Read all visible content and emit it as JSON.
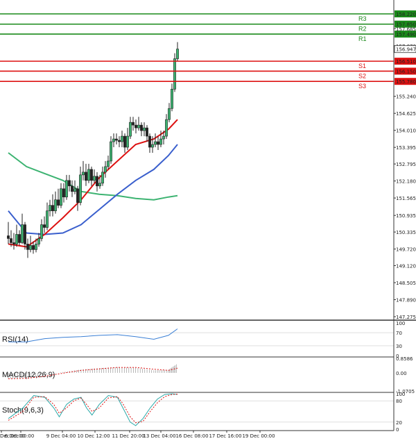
{
  "chart_data": {
    "type": "candlestick",
    "y_axis_labels": [
      "158.220",
      "157.850",
      "157.685",
      "157.490",
      "157.070",
      "156.947",
      "156.510",
      "156.150",
      "155.780",
      "155.240",
      "154.625",
      "154.010",
      "153.395",
      "152.795",
      "152.180",
      "151.565",
      "150.935",
      "150.335",
      "149.720",
      "149.120",
      "148.505",
      "147.890",
      "147.275"
    ],
    "x_labels": [
      "Dec 00:00",
      "6 Dec 00:00",
      "9 Dec 04:00",
      "10 Dec 12:00",
      "11 Dec 20:00",
      "13 Dec 04:00",
      "16 Dec 08:00",
      "17 Dec 16:00",
      "19 Dec 00:00"
    ],
    "ylim": [
      147.275,
      158.5
    ],
    "current_price": 156.947,
    "levels": [
      {
        "name": "R3",
        "value": 158.22,
        "price_label": "158.220",
        "color": "#1a8a1a"
      },
      {
        "name": "R2",
        "value": 157.85,
        "price_label": "157.850",
        "color": "#1a8a1a"
      },
      {
        "name": "R1",
        "value": 157.49,
        "price_label": "157.490",
        "color": "#1a8a1a"
      },
      {
        "name": "S1",
        "value": 156.51,
        "price_label": "156.510",
        "color": "#dd1111"
      },
      {
        "name": "S2",
        "value": 156.15,
        "price_label": "156.150",
        "color": "#dd1111"
      },
      {
        "name": "S3",
        "value": 155.78,
        "price_label": "155.780",
        "color": "#dd1111"
      }
    ],
    "level_tags": [
      "R3",
      "R2",
      "R1",
      "S1",
      "S2",
      "S3"
    ],
    "candles": [
      [
        150.2,
        150.1,
        150.7,
        149.9
      ],
      [
        150.1,
        149.95,
        150.4,
        149.8
      ],
      [
        149.95,
        149.9,
        150.3,
        149.7
      ],
      [
        149.9,
        150.25,
        150.6,
        149.8
      ],
      [
        150.25,
        149.95,
        150.4,
        149.85
      ],
      [
        149.95,
        150.6,
        151.0,
        149.9
      ],
      [
        150.6,
        149.9,
        150.7,
        149.7
      ],
      [
        149.9,
        149.7,
        150.1,
        149.4
      ],
      [
        149.7,
        149.85,
        150.2,
        149.6
      ],
      [
        149.85,
        149.7,
        150.0,
        149.55
      ],
      [
        149.7,
        149.9,
        150.1,
        149.6
      ],
      [
        149.9,
        150.1,
        150.3,
        149.8
      ],
      [
        150.1,
        150.6,
        150.8,
        150.0
      ],
      [
        150.6,
        150.5,
        150.9,
        150.3
      ],
      [
        150.5,
        151.1,
        151.4,
        150.4
      ],
      [
        151.1,
        151.3,
        151.5,
        150.9
      ],
      [
        151.3,
        151.1,
        151.7,
        150.9
      ],
      [
        151.1,
        151.5,
        151.8,
        151.0
      ],
      [
        151.5,
        151.3,
        151.9,
        151.2
      ],
      [
        151.3,
        151.9,
        152.1,
        151.2
      ],
      [
        151.9,
        151.6,
        152.1,
        151.4
      ],
      [
        151.6,
        152.2,
        152.4,
        151.5
      ],
      [
        152.2,
        152.0,
        152.4,
        151.8
      ],
      [
        152.0,
        151.8,
        152.2,
        151.6
      ],
      [
        151.8,
        151.9,
        152.2,
        151.7
      ],
      [
        151.9,
        151.4,
        152.0,
        151.1
      ],
      [
        151.4,
        152.4,
        152.7,
        151.3
      ],
      [
        152.4,
        152.5,
        152.9,
        152.2
      ],
      [
        152.5,
        152.2,
        152.8,
        152.0
      ],
      [
        152.2,
        152.6,
        152.8,
        152.1
      ],
      [
        152.6,
        152.2,
        152.7,
        152.0
      ],
      [
        152.2,
        152.35,
        152.6,
        152.1
      ],
      [
        152.35,
        152.0,
        152.5,
        151.8
      ],
      [
        152.0,
        152.1,
        152.4,
        151.9
      ],
      [
        152.1,
        152.5,
        152.7,
        152.0
      ],
      [
        152.5,
        152.7,
        152.9,
        152.3
      ],
      [
        152.7,
        152.9,
        153.1,
        152.6
      ],
      [
        152.9,
        153.6,
        153.8,
        152.8
      ],
      [
        153.6,
        153.7,
        153.9,
        153.4
      ],
      [
        153.7,
        153.65,
        153.9,
        153.5
      ],
      [
        153.65,
        153.6,
        153.8,
        153.4
      ],
      [
        153.6,
        153.8,
        154.0,
        153.4
      ],
      [
        153.8,
        153.4,
        153.9,
        153.2
      ],
      [
        153.4,
        153.8,
        154.1,
        153.3
      ],
      [
        153.8,
        154.3,
        154.5,
        153.7
      ],
      [
        154.3,
        154.2,
        154.5,
        154.0
      ],
      [
        154.2,
        154.1,
        154.4,
        153.9
      ],
      [
        154.1,
        154.2,
        154.5,
        154.0
      ],
      [
        154.2,
        154.0,
        154.3,
        153.8
      ],
      [
        154.0,
        154.1,
        154.3,
        153.8
      ],
      [
        154.1,
        153.8,
        154.2,
        153.6
      ],
      [
        153.8,
        153.4,
        153.9,
        153.2
      ],
      [
        153.4,
        153.5,
        153.8,
        153.2
      ],
      [
        153.5,
        153.6,
        153.9,
        153.4
      ],
      [
        153.6,
        153.5,
        153.8,
        153.3
      ],
      [
        153.5,
        153.7,
        154.0,
        153.4
      ],
      [
        153.7,
        153.8,
        154.0,
        153.5
      ],
      [
        153.8,
        154.4,
        154.6,
        153.7
      ],
      [
        154.4,
        154.8,
        155.0,
        154.3
      ],
      [
        154.8,
        155.5,
        155.7,
        154.7
      ],
      [
        155.5,
        156.6,
        156.8,
        155.4
      ],
      [
        156.6,
        156.95,
        157.2,
        156.5
      ]
    ],
    "ma_red": [
      [
        0,
        149.9
      ],
      [
        10,
        149.8
      ],
      [
        20,
        150.25
      ],
      [
        30,
        150.85
      ],
      [
        40,
        151.5
      ],
      [
        50,
        152.3
      ],
      [
        60,
        152.9
      ],
      [
        70,
        153.5
      ],
      [
        80,
        153.7
      ],
      [
        88,
        154.05
      ],
      [
        93,
        154.4
      ]
    ],
    "ma_blue": [
      [
        0,
        151.1
      ],
      [
        10,
        150.3
      ],
      [
        20,
        150.25
      ],
      [
        30,
        150.3
      ],
      [
        40,
        150.6
      ],
      [
        50,
        151.15
      ],
      [
        60,
        151.7
      ],
      [
        70,
        152.2
      ],
      [
        80,
        152.6
      ],
      [
        88,
        153.1
      ],
      [
        93,
        153.5
      ]
    ],
    "ma_green": [
      [
        0,
        153.2
      ],
      [
        10,
        152.7
      ],
      [
        20,
        152.45
      ],
      [
        30,
        152.2
      ],
      [
        40,
        151.8
      ],
      [
        50,
        151.7
      ],
      [
        60,
        151.65
      ],
      [
        70,
        151.55
      ],
      [
        80,
        151.5
      ],
      [
        88,
        151.6
      ],
      [
        93,
        151.65
      ]
    ],
    "indicators": [
      {
        "name": "RSI(14)",
        "axis_labels": [
          "100",
          "70",
          "30",
          "0"
        ],
        "range": [
          0,
          100
        ],
        "ref_levels": [
          70,
          30
        ],
        "series": [
          [
            0,
            42
          ],
          [
            10,
            42
          ],
          [
            20,
            52
          ],
          [
            30,
            56
          ],
          [
            40,
            58
          ],
          [
            50,
            62
          ],
          [
            60,
            64
          ],
          [
            70,
            58
          ],
          [
            80,
            50
          ],
          [
            88,
            62
          ],
          [
            93,
            82
          ]
        ]
      },
      {
        "name": "MACD(12,26,9)",
        "axis_labels": [
          "0.8586",
          "0.00",
          "-1.0705"
        ],
        "range": [
          -1.0705,
          0.8586
        ],
        "macd": [
          [
            0,
            -0.35
          ],
          [
            10,
            -0.3
          ],
          [
            20,
            -0.15
          ],
          [
            30,
            0.05
          ],
          [
            40,
            0.2
          ],
          [
            50,
            0.28
          ],
          [
            60,
            0.34
          ],
          [
            70,
            0.3
          ],
          [
            80,
            0.15
          ],
          [
            88,
            0.18
          ],
          [
            93,
            0.55
          ]
        ],
        "signal": [
          [
            0,
            -0.35
          ],
          [
            10,
            -0.32
          ],
          [
            20,
            -0.2
          ],
          [
            30,
            -0.02
          ],
          [
            40,
            0.15
          ],
          [
            50,
            0.24
          ],
          [
            60,
            0.32
          ],
          [
            70,
            0.32
          ],
          [
            80,
            0.22
          ],
          [
            88,
            0.15
          ],
          [
            93,
            0.28
          ]
        ]
      },
      {
        "name": "Stoch(9,6,3)",
        "axis_labels": [
          "100",
          "80",
          "20",
          "0"
        ],
        "range": [
          0,
          100
        ],
        "ref_levels": [
          80,
          20
        ],
        "k": [
          [
            0,
            30
          ],
          [
            8,
            60
          ],
          [
            14,
            95
          ],
          [
            20,
            90
          ],
          [
            25,
            60
          ],
          [
            28,
            35
          ],
          [
            32,
            70
          ],
          [
            36,
            85
          ],
          [
            40,
            90
          ],
          [
            43,
            60
          ],
          [
            46,
            40
          ],
          [
            50,
            70
          ],
          [
            55,
            95
          ],
          [
            60,
            90
          ],
          [
            63,
            60
          ],
          [
            67,
            20
          ],
          [
            70,
            10
          ],
          [
            74,
            30
          ],
          [
            78,
            60
          ],
          [
            82,
            85
          ],
          [
            86,
            98
          ],
          [
            90,
            100
          ],
          [
            93,
            98
          ]
        ],
        "d": [
          [
            0,
            25
          ],
          [
            8,
            50
          ],
          [
            14,
            90
          ],
          [
            20,
            92
          ],
          [
            25,
            70
          ],
          [
            28,
            45
          ],
          [
            32,
            60
          ],
          [
            36,
            80
          ],
          [
            40,
            88
          ],
          [
            43,
            70
          ],
          [
            46,
            50
          ],
          [
            50,
            60
          ],
          [
            55,
            88
          ],
          [
            60,
            92
          ],
          [
            63,
            72
          ],
          [
            67,
            35
          ],
          [
            70,
            18
          ],
          [
            74,
            22
          ],
          [
            78,
            50
          ],
          [
            82,
            75
          ],
          [
            86,
            92
          ],
          [
            90,
            98
          ],
          [
            93,
            99
          ]
        ]
      }
    ]
  }
}
